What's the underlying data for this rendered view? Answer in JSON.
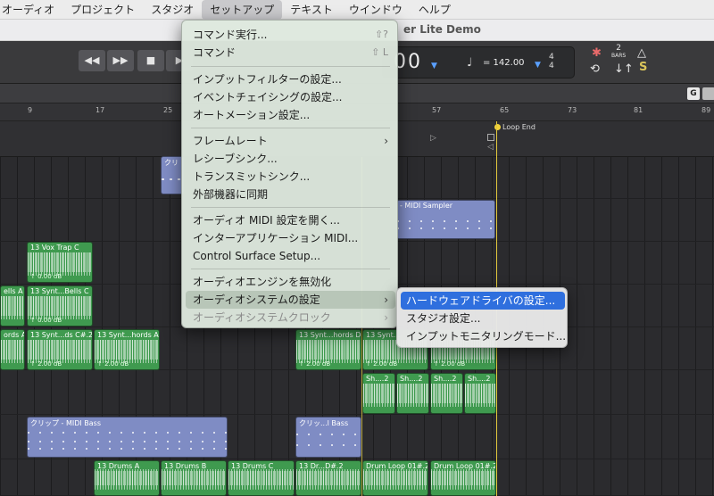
{
  "menubar": {
    "items": [
      "オーディオ",
      "プロジェクト",
      "スタジオ",
      "セットアップ",
      "テキスト",
      "ウインドウ",
      "ヘルプ"
    ]
  },
  "window": {
    "title_fragment": "er Lite Demo"
  },
  "controlbar": {
    "rewind_icon": "rewind-icon",
    "forward_icon": "fast-forward-icon",
    "stop_icon": "stop-icon",
    "position": "00",
    "note_symbol": "♩",
    "tempo": "= 142.00",
    "time_sig_top": "4",
    "time_sig_bottom": "4",
    "bars_num": "2",
    "bars_label": "BARS",
    "solo_label": "S",
    "header_g": "G"
  },
  "ruler": {
    "bars": [
      "9",
      "17",
      "25",
      "57",
      "65",
      "73",
      "81",
      "89"
    ],
    "loop_end": "Loop End"
  },
  "regions": [
    {
      "label": "クリ"
    },
    {
      "label": "- MIDI Sampler"
    },
    {
      "label": "13 Vox Trap C",
      "gain": "↑ 0.00 dB"
    },
    {
      "label": "ells A"
    },
    {
      "label": "13 Synt...Bells C",
      "gain": "↑ 0.00 dB"
    },
    {
      "label": "ords A"
    },
    {
      "label": "13 Synt...ds C#.2",
      "gain": "↑ 2.00 dB"
    },
    {
      "label": "13 Synt...hords A",
      "gain": "↑ 2.00 dB"
    },
    {
      "label": "13 Synt...hords D",
      "gain": "↑ 2.00 dB"
    },
    {
      "label": "13 Synt...",
      "gain": "↑ 2.00 dB"
    },
    {
      "label": "",
      "gain": "↑ 2.00 dB"
    },
    {
      "label": "Sh....2"
    },
    {
      "label": "Sh....2"
    },
    {
      "label": "Sh....2"
    },
    {
      "label": "Sh....2"
    },
    {
      "label": "クリップ - MIDI Bass"
    },
    {
      "label": "クリッ...l Bass"
    },
    {
      "label": "13 Drums A"
    },
    {
      "label": "13 Drums B"
    },
    {
      "label": "13 Drums C"
    },
    {
      "label": "13 Dr...D#.2"
    },
    {
      "label": "Drum Loop 01#.2"
    },
    {
      "label": "Drum Loop 01#.2"
    }
  ],
  "setup_menu": {
    "items": [
      {
        "label": "コマンド実行...",
        "shortcut": "⇧?"
      },
      {
        "label": "コマンド",
        "shortcut": "⇧ L"
      },
      {
        "label": "インプットフィルターの設定..."
      },
      {
        "label": "イベントチェイシングの設定..."
      },
      {
        "label": "オートメーション設定..."
      },
      {
        "label": "フレームレート",
        "submenu": "›"
      },
      {
        "label": "レシーブシンク..."
      },
      {
        "label": "トランスミットシンク..."
      },
      {
        "label": "外部機器に同期"
      },
      {
        "label": "オーディオ MIDI 設定を開く..."
      },
      {
        "label": "インターアプリケーション MIDI..."
      },
      {
        "label": "Control Surface Setup..."
      },
      {
        "label": "オーディオエンジンを無効化"
      },
      {
        "label": "オーディオシステムの設定",
        "submenu": "›"
      },
      {
        "label": "オーディオシステムクロック",
        "submenu": "›"
      }
    ]
  },
  "audio_system_submenu": {
    "items": [
      {
        "label": "ハードウェアドライバの設定..."
      },
      {
        "label": "スタジオ設定..."
      },
      {
        "label": "インプットモニタリングモード..."
      }
    ]
  }
}
